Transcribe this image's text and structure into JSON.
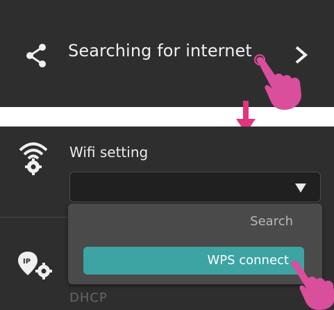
{
  "top_row": {
    "title": "Searching for internet",
    "share_icon": "share-icon",
    "chevron_icon": "chevron-right-icon"
  },
  "wifi_setting": {
    "label": "Wifi setting",
    "icon": "wifi-gear-icon",
    "dropdown_caret": "caret-down-icon"
  },
  "dropdown_menu": {
    "items": [
      {
        "label": "Search",
        "selected": false
      },
      {
        "label": "WPS connect",
        "selected": true
      }
    ]
  },
  "ip_row": {
    "icon": "ip-gear-icon",
    "partial_text": "DHCP"
  },
  "colors": {
    "panel": "#2e2e2e",
    "accent_teal": "#3da3a3",
    "pointer_pink": "#d94f9c"
  }
}
